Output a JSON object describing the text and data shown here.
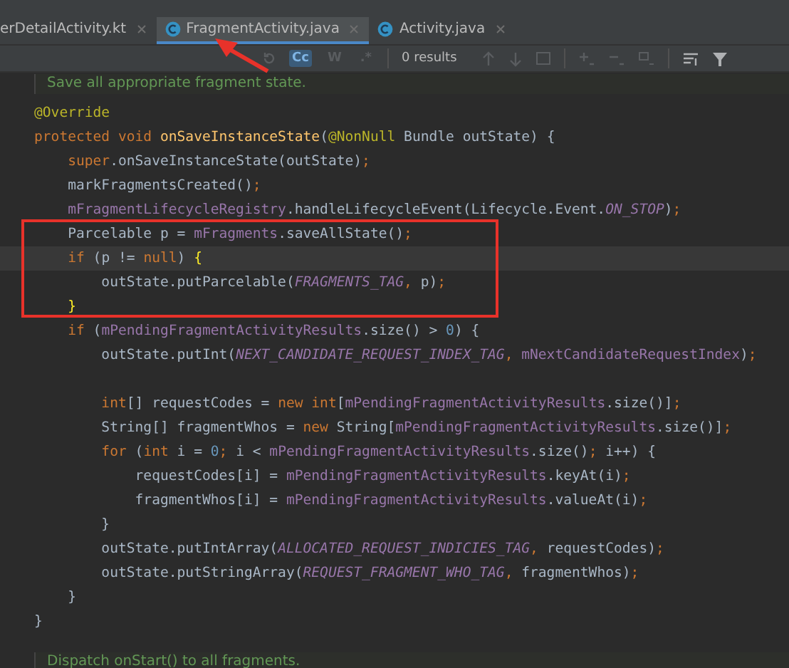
{
  "tabs": [
    {
      "label": "erDetailActivity.kt",
      "selected": false,
      "kind": "kotlin"
    },
    {
      "label": "FragmentActivity.java",
      "selected": true,
      "kind": "class"
    },
    {
      "label": "Activity.java",
      "selected": false,
      "kind": "class"
    }
  ],
  "find_toolbar": {
    "options": [
      {
        "label": "Cc",
        "selected": true
      },
      {
        "label": "W",
        "selected": false
      },
      {
        "label": ".*",
        "selected": false
      }
    ],
    "results": "0 results"
  },
  "editor": {
    "doc_comment": "Save all appropriate fragment state.",
    "lines": [
      {
        "current": false,
        "tokens": [
          {
            "t": "@Override",
            "color": "#bbb529"
          }
        ]
      },
      {
        "current": false,
        "tokens": [
          {
            "t": "protected void ",
            "color": "#cc7832"
          },
          {
            "t": "onSaveInstanceState",
            "color": "#ffc66d"
          },
          {
            "t": "(",
            "color": "#a9b7c6"
          },
          {
            "t": "@NonNull",
            "color": "#bbb529"
          },
          {
            "t": " Bundle outState) {",
            "color": "#a9b7c6"
          }
        ]
      },
      {
        "current": false,
        "tokens": [
          {
            "t": "    super",
            "color": "#cc7832"
          },
          {
            "t": ".onSaveInstanceState(outState)",
            "color": "#a9b7c6"
          },
          {
            "t": ";",
            "color": "#cc7832"
          }
        ]
      },
      {
        "current": false,
        "tokens": [
          {
            "t": "    markFragmentsCreated()",
            "color": "#a9b7c6"
          },
          {
            "t": ";",
            "color": "#cc7832"
          }
        ]
      },
      {
        "current": false,
        "tokens": [
          {
            "t": "    mFragmentLifecycleRegistry",
            "color": "#9876aa"
          },
          {
            "t": ".handleLifecycleEvent(Lifecycle.Event.",
            "color": "#a9b7c6"
          },
          {
            "t": "*ON_STOP*",
            "color": "#9876aa"
          },
          {
            "t": ")",
            "color": "#a9b7c6"
          },
          {
            "t": ";",
            "color": "#cc7832"
          }
        ]
      },
      {
        "current": false,
        "tokens": [
          {
            "t": "    Parcelable p = ",
            "color": "#a9b7c6"
          },
          {
            "t": "mFragments",
            "color": "#9876aa"
          },
          {
            "t": ".saveAllState()",
            "color": "#a9b7c6"
          },
          {
            "t": ";",
            "color": "#cc7832"
          }
        ]
      },
      {
        "current": true,
        "tokens": [
          {
            "t": "    if ",
            "color": "#cc7832"
          },
          {
            "t": "(p != ",
            "color": "#a9b7c6"
          },
          {
            "t": "null",
            "color": "#cc7832"
          },
          {
            "t": ") ",
            "color": "#a9b7c6"
          },
          {
            "t": "{",
            "color": "#ffef28"
          }
        ]
      },
      {
        "current": false,
        "tokens": [
          {
            "t": "        outState.putParcelable(",
            "color": "#a9b7c6"
          },
          {
            "t": "*FRAGMENTS_TAG*",
            "color": "#9876aa"
          },
          {
            "t": ",",
            "color": "#cc7832"
          },
          {
            "t": " p)",
            "color": "#a9b7c6"
          },
          {
            "t": ";",
            "color": "#cc7832"
          }
        ]
      },
      {
        "current": false,
        "tokens": [
          {
            "t": "    }",
            "color": "#ffef28"
          }
        ]
      },
      {
        "current": false,
        "tokens": [
          {
            "t": "    if ",
            "color": "#cc7832"
          },
          {
            "t": "(",
            "color": "#a9b7c6"
          },
          {
            "t": "mPendingFragmentActivityResults",
            "color": "#9876aa"
          },
          {
            "t": ".size() > ",
            "color": "#a9b7c6"
          },
          {
            "t": "0",
            "color": "#6897bb"
          },
          {
            "t": ") {",
            "color": "#a9b7c6"
          }
        ]
      },
      {
        "current": false,
        "tokens": [
          {
            "t": "        outState.putInt(",
            "color": "#a9b7c6"
          },
          {
            "t": "*NEXT_CANDIDATE_REQUEST_INDEX_TAG*",
            "color": "#9876aa"
          },
          {
            "t": ",",
            "color": "#cc7832"
          },
          {
            "t": " mNextCandidateRequestIndex",
            "color": "#9876aa"
          },
          {
            "t": ")",
            "color": "#a9b7c6"
          },
          {
            "t": ";",
            "color": "#cc7832"
          }
        ]
      },
      {
        "current": false
      },
      {
        "current": false,
        "tokens": [
          {
            "t": "        int",
            "color": "#cc7832"
          },
          {
            "t": "[] requestCodes = ",
            "color": "#a9b7c6"
          },
          {
            "t": "new int",
            "color": "#cc7832"
          },
          {
            "t": "[",
            "color": "#a9b7c6"
          },
          {
            "t": "mPendingFragmentActivityResults",
            "color": "#9876aa"
          },
          {
            "t": ".size()]",
            "color": "#a9b7c6"
          },
          {
            "t": ";",
            "color": "#cc7832"
          }
        ]
      },
      {
        "current": false,
        "tokens": [
          {
            "t": "        String[] fragmentWhos = ",
            "color": "#a9b7c6"
          },
          {
            "t": "new ",
            "color": "#cc7832"
          },
          {
            "t": "String[",
            "color": "#a9b7c6"
          },
          {
            "t": "mPendingFragmentActivityResults",
            "color": "#9876aa"
          },
          {
            "t": ".size()]",
            "color": "#a9b7c6"
          },
          {
            "t": ";",
            "color": "#cc7832"
          }
        ]
      },
      {
        "current": false,
        "tokens": [
          {
            "t": "        for ",
            "color": "#cc7832"
          },
          {
            "t": "(",
            "color": "#a9b7c6"
          },
          {
            "t": "int ",
            "color": "#cc7832"
          },
          {
            "t": "i = ",
            "color": "#a9b7c6"
          },
          {
            "t": "0",
            "color": "#6897bb"
          },
          {
            "t": "; ",
            "color": "#cc7832"
          },
          {
            "t": "i < ",
            "color": "#a9b7c6"
          },
          {
            "t": "mPendingFragmentActivityResults",
            "color": "#9876aa"
          },
          {
            "t": ".size()",
            "color": "#a9b7c6"
          },
          {
            "t": "; ",
            "color": "#cc7832"
          },
          {
            "t": "i++) {",
            "color": "#a9b7c6"
          }
        ]
      },
      {
        "current": false,
        "tokens": [
          {
            "t": "            requestCodes[i] = ",
            "color": "#a9b7c6"
          },
          {
            "t": "mPendingFragmentActivityResults",
            "color": "#9876aa"
          },
          {
            "t": ".keyAt(i)",
            "color": "#a9b7c6"
          },
          {
            "t": ";",
            "color": "#cc7832"
          }
        ]
      },
      {
        "current": false,
        "tokens": [
          {
            "t": "            fragmentWhos[i] = ",
            "color": "#a9b7c6"
          },
          {
            "t": "mPendingFragmentActivityResults",
            "color": "#9876aa"
          },
          {
            "t": ".valueAt(i)",
            "color": "#a9b7c6"
          },
          {
            "t": ";",
            "color": "#cc7832"
          }
        ]
      },
      {
        "current": false,
        "tokens": [
          {
            "t": "        }",
            "color": "#a9b7c6"
          }
        ]
      },
      {
        "current": false,
        "tokens": [
          {
            "t": "        outState.putIntArray(",
            "color": "#a9b7c6"
          },
          {
            "t": "*ALLOCATED_REQUEST_INDICIES_TAG*",
            "color": "#9876aa"
          },
          {
            "t": ",",
            "color": "#cc7832"
          },
          {
            "t": " requestCodes)",
            "color": "#a9b7c6"
          },
          {
            "t": ";",
            "color": "#cc7832"
          }
        ]
      },
      {
        "current": false,
        "tokens": [
          {
            "t": "        outState.putStringArray(",
            "color": "#a9b7c6"
          },
          {
            "t": "*REQUEST_FRAGMENT_WHO_TAG*",
            "color": "#9876aa"
          },
          {
            "t": ",",
            "color": "#cc7832"
          },
          {
            "t": " fragmentWhos)",
            "color": "#a9b7c6"
          },
          {
            "t": ";",
            "color": "#cc7832"
          }
        ]
      },
      {
        "current": false,
        "tokens": [
          {
            "t": "    }",
            "color": "#a9b7c6"
          }
        ]
      },
      {
        "current": false,
        "tokens": [
          {
            "t": "}",
            "color": "#a9b7c6"
          }
        ]
      }
    ],
    "footer_comment": "Dispatch onStart() to all fragments."
  }
}
